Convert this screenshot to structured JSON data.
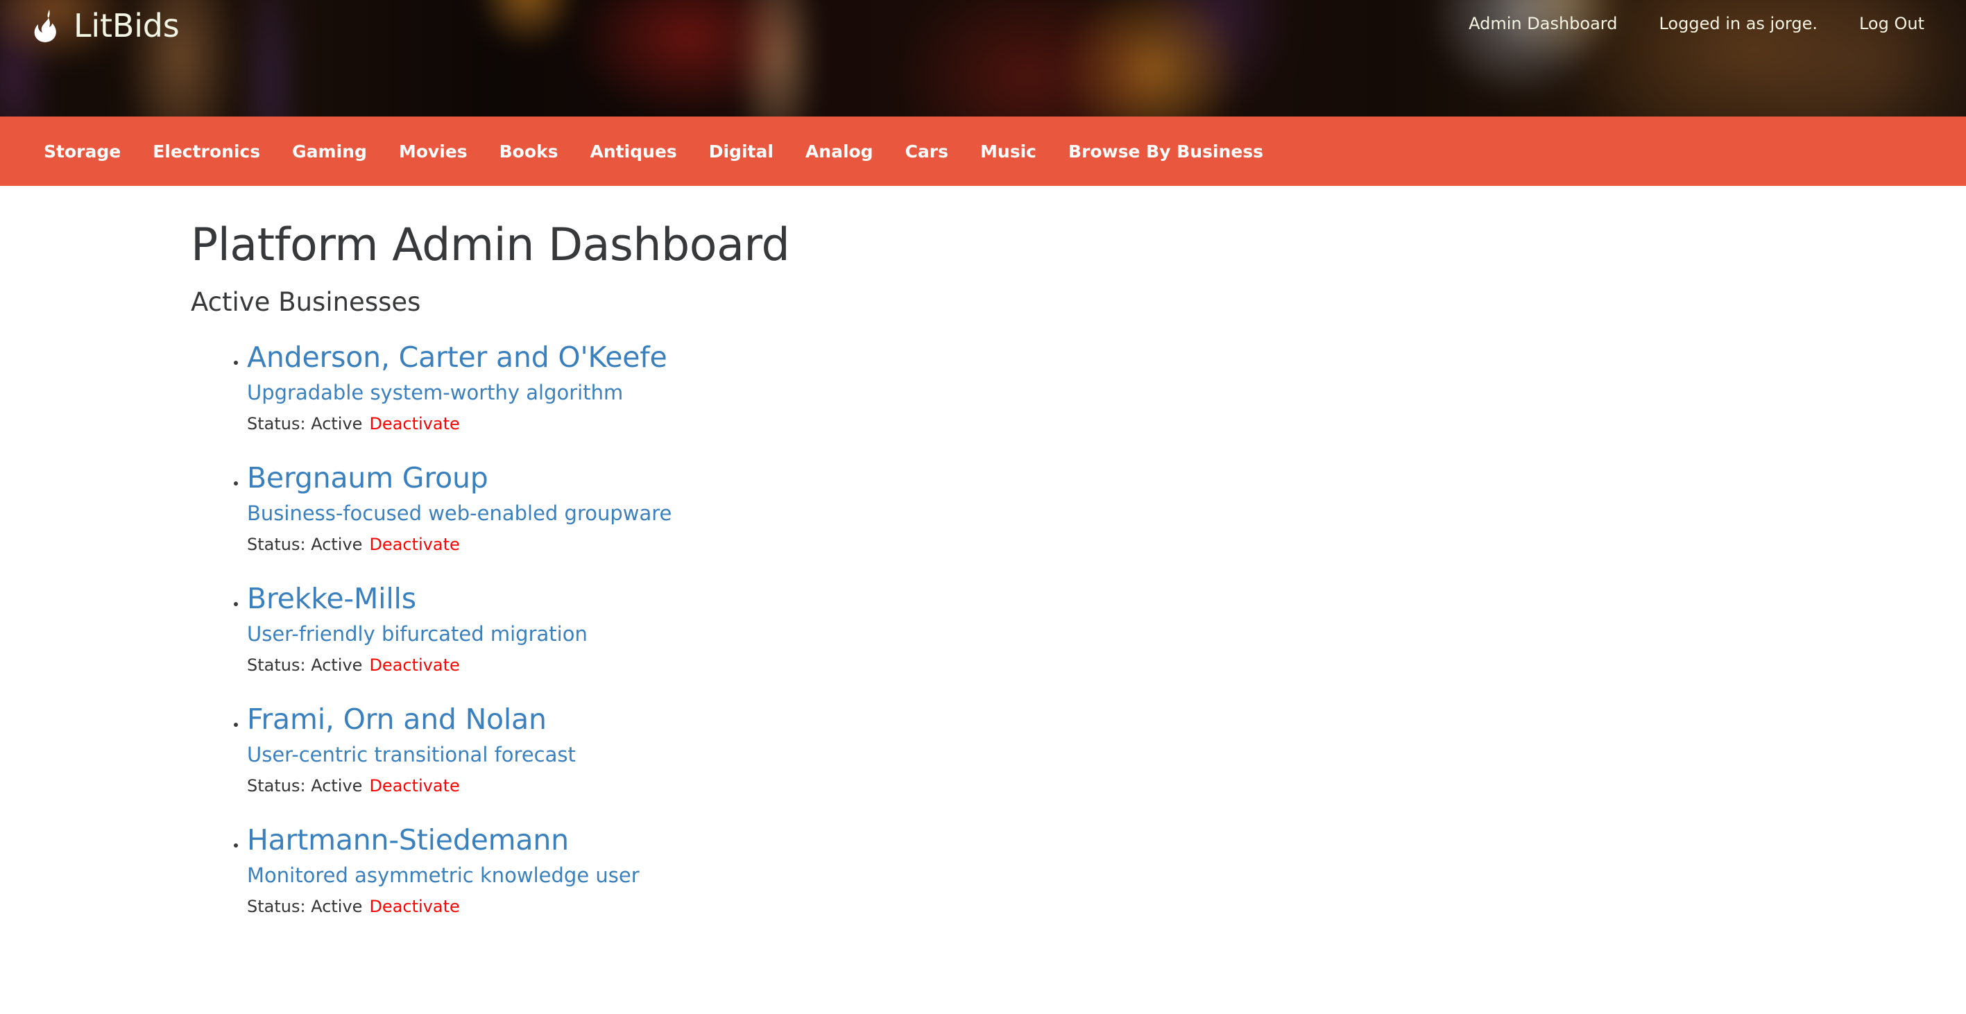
{
  "brand": {
    "name": "LitBids",
    "icon": "flame-icon"
  },
  "masthead": {
    "admin_dashboard": "Admin Dashboard",
    "logged_in_as": "Logged in as jorge.",
    "log_out": "Log Out"
  },
  "category_nav": {
    "items": [
      {
        "label": "Storage"
      },
      {
        "label": "Electronics"
      },
      {
        "label": "Gaming"
      },
      {
        "label": "Movies"
      },
      {
        "label": "Books"
      },
      {
        "label": "Antiques"
      },
      {
        "label": "Digital"
      },
      {
        "label": "Analog"
      },
      {
        "label": "Cars"
      },
      {
        "label": "Music"
      },
      {
        "label": "Browse By Business"
      }
    ]
  },
  "main": {
    "page_title": "Platform Admin Dashboard",
    "section_title": "Active Businesses",
    "status_label": "Status:",
    "status_value": "Active",
    "deactivate_label": "Deactivate",
    "businesses": [
      {
        "name": "Anderson, Carter and O'Keefe",
        "description": "Upgradable system-worthy algorithm",
        "status": "Active",
        "action": "Deactivate"
      },
      {
        "name": "Bergnaum Group",
        "description": "Business-focused web-enabled groupware",
        "status": "Active",
        "action": "Deactivate"
      },
      {
        "name": "Brekke-Mills",
        "description": "User-friendly bifurcated migration",
        "status": "Active",
        "action": "Deactivate"
      },
      {
        "name": "Frami, Orn and Nolan",
        "description": "User-centric transitional forecast",
        "status": "Active",
        "action": "Deactivate"
      },
      {
        "name": "Hartmann-Stiedemann",
        "description": "Monitored asymmetric knowledge user",
        "status": "Active",
        "action": "Deactivate"
      }
    ]
  },
  "colors": {
    "nav_orange": "#e9573f",
    "link_blue": "#3a80be",
    "deactivate_red": "#ff0000",
    "heading_gray": "#37383a",
    "masthead_text": "#f4f3e2"
  }
}
